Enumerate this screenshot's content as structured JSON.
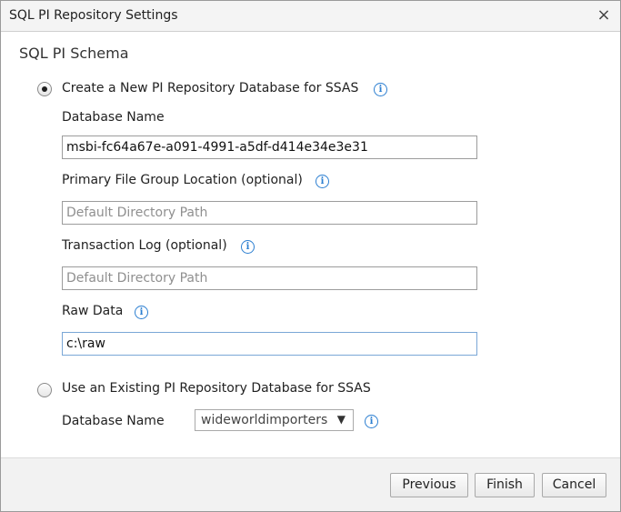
{
  "window": {
    "title": "SQL PI Repository Settings",
    "close_glyph": "×"
  },
  "section": {
    "title": "SQL PI Schema"
  },
  "create_new": {
    "label": "Create a New PI Repository Database for SSAS",
    "selected": true,
    "database_name_label": "Database Name",
    "database_name_value": "msbi-fc64a67e-a091-4991-a5df-d414e34e3e31",
    "primary_file_group_label": "Primary File Group Location (optional)",
    "primary_file_group_placeholder": "Default Directory Path",
    "transaction_log_label": "Transaction Log (optional)",
    "transaction_log_placeholder": "Default Directory Path",
    "raw_data_label": "Raw Data",
    "raw_data_value": "c:\\raw"
  },
  "use_existing": {
    "label": "Use an Existing PI Repository Database for SSAS",
    "selected": false,
    "database_name_label": "Database Name",
    "database_selected": "wideworldimporters",
    "dropdown_glyph": "▼"
  },
  "info_glyph": "i",
  "footer": {
    "previous_label": "Previous",
    "finish_label": "Finish",
    "cancel_label": "Cancel"
  },
  "icons": {
    "info": "info-icon",
    "close": "close-icon",
    "dropdown": "chevron-down-icon"
  },
  "colors": {
    "info_accent": "#2c7fd1",
    "footer_bg": "#f2f2f2"
  }
}
